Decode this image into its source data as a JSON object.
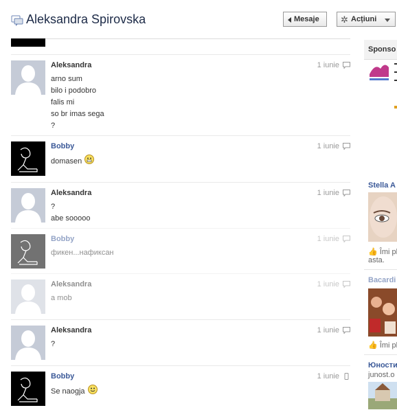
{
  "header": {
    "title": "Aleksandra Spirovska",
    "mesaje_label": "Mesaje",
    "actiuni_label": "Acțiuni"
  },
  "messages": [
    {
      "name": "Aleksandra",
      "date": "1 iunie",
      "lines": [
        "arno sum",
        "bilo i podobro",
        "falis mi",
        "so br imas sega",
        "?"
      ]
    },
    {
      "name": "Bobby",
      "date": "1 iunie",
      "lines": [
        "domasen"
      ]
    },
    {
      "name": "Aleksandra",
      "date": "1 iunie",
      "lines": [
        "?",
        "abe sooooo"
      ]
    },
    {
      "name": "Bobby",
      "date": "1 iunie",
      "lines": [
        "фикен...нафиксан"
      ]
    },
    {
      "name": "Aleksandra",
      "date": "1 iunie",
      "lines": [
        "a mob"
      ]
    },
    {
      "name": "Aleksandra",
      "date": "1 iunie",
      "lines": [
        "?"
      ]
    },
    {
      "name": "Bobby",
      "date": "1 iunie",
      "lines": [
        "Se naogja"
      ]
    }
  ],
  "sidebar": {
    "sponsored_label": "Sponso",
    "ads": [
      {
        "title": "Stella A",
        "like": "Îmi pl",
        "sub": "asta."
      },
      {
        "title": "Bacardi",
        "like": "Îmi pl",
        "sub": ""
      },
      {
        "title": "Юности",
        "like": "",
        "sub": "junost.o"
      }
    ]
  },
  "colors": {
    "link": "#3b5998",
    "title": "#1c2a47",
    "avatar_placeholder": "#c5cbd7"
  }
}
